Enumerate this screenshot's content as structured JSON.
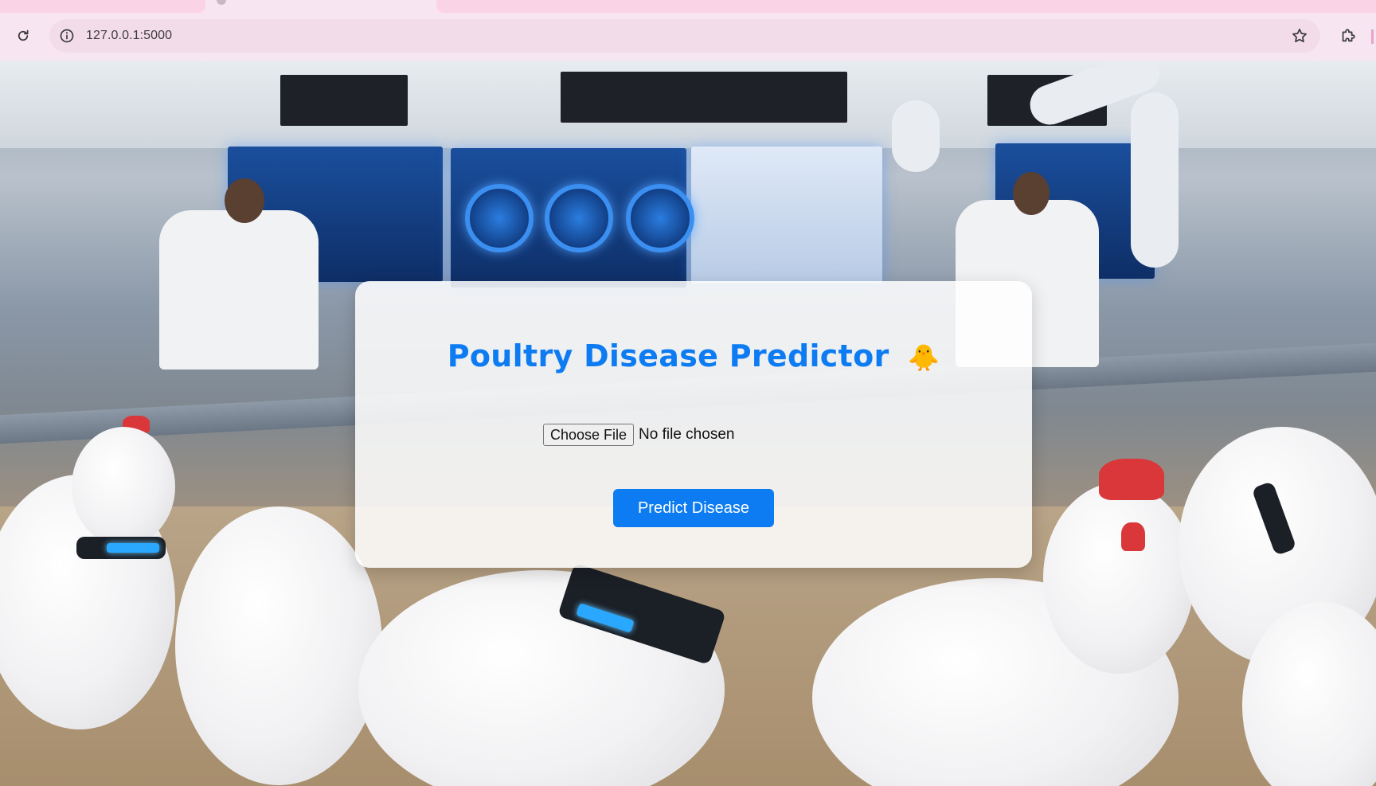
{
  "browser": {
    "url": "127.0.0.1:5000",
    "icons": {
      "reload": "reload-icon",
      "site_info": "info-icon",
      "bookmark": "star-icon",
      "extensions": "puzzle-icon"
    }
  },
  "page": {
    "title": "Poultry Disease Predictor",
    "title_emoji": "🐥",
    "file_input": {
      "button_label": "Choose File",
      "status": "No file chosen"
    },
    "submit_label": "Predict Disease",
    "accent_color": "#0d7cf2"
  }
}
